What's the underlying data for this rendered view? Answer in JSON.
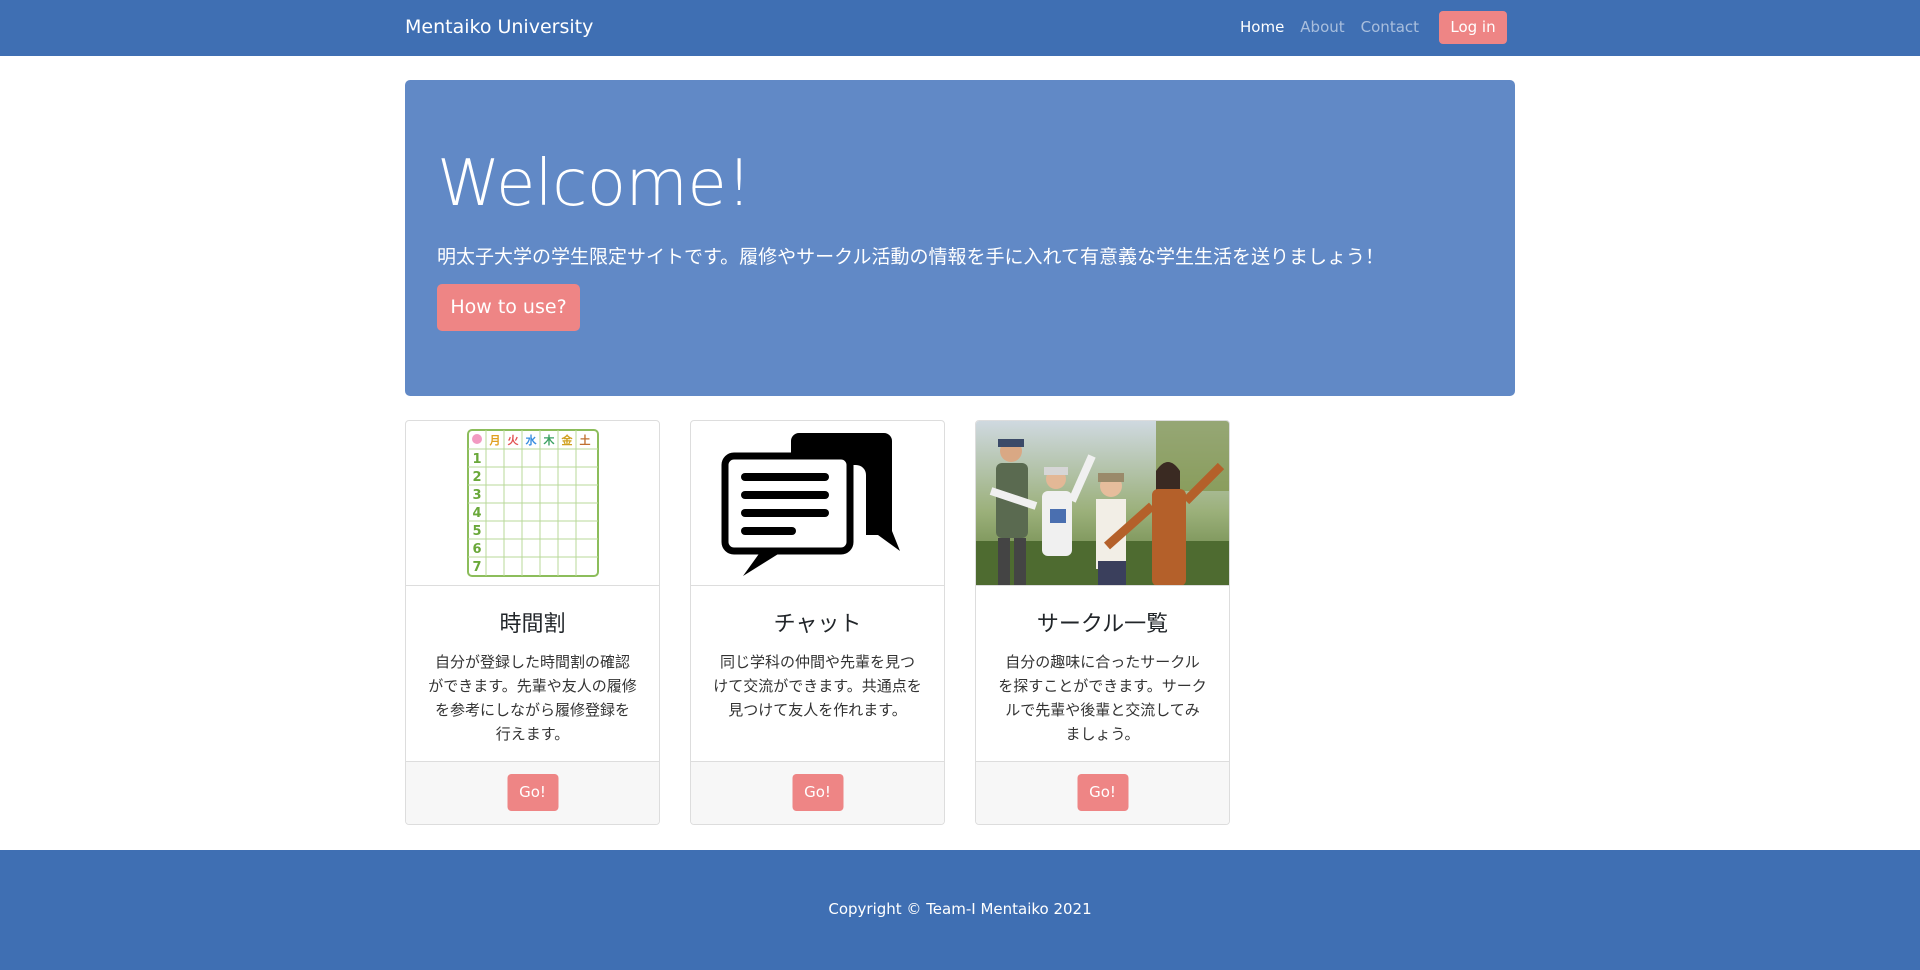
{
  "navbar": {
    "brand": "Mentaiko University",
    "links": [
      "Home",
      "About",
      "Contact"
    ],
    "login": "Log in"
  },
  "hero": {
    "title": "Welcome!",
    "lead": "明太子大学の学生限定サイトです。履修やサークル活動の情報を手に入れて有意義な学生生活を送りましょう！",
    "button": "How to use?"
  },
  "cards": [
    {
      "icon": "timetable-icon",
      "title": "時間割",
      "text": "自分が登録した時間割の確認ができます。先輩や友人の履修を参考にしながら履修登録を行えます。",
      "timetable_days": [
        "月",
        "火",
        "水",
        "木",
        "金",
        "土"
      ],
      "timetable_periods": [
        "1",
        "2",
        "3",
        "4",
        "5",
        "6",
        "7"
      ],
      "button": "Go!"
    },
    {
      "icon": "chat-bubbles-icon",
      "title": "チャット",
      "text": "同じ学科の仲間や先輩を見つけて交流ができます。共通点を見つけて友人を作れます。",
      "button": "Go!"
    },
    {
      "icon": "students-photo",
      "title": "サークル一覧",
      "text": "自分の趣味に合ったサークルを探すことができます。サークルで先輩や後輩と交流してみましょう。",
      "button": "Go!"
    }
  ],
  "footer": {
    "copyright": "Copyright © Team-I Mentaiko 2021"
  },
  "colors": {
    "primary": "#3f6fb3",
    "hero": "#6189c6",
    "accent": "#ee8585"
  }
}
